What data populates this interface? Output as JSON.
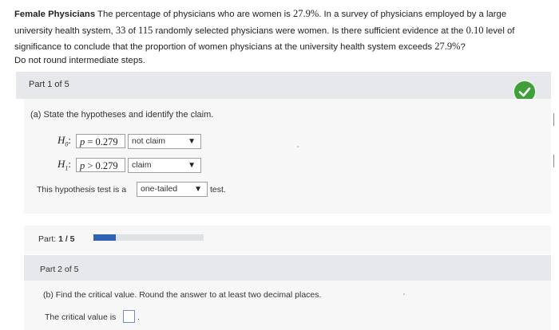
{
  "problem": {
    "title": "Female Physicians",
    "sentence1_a": " The percentage of physicians who are women is ",
    "pct": "27.9%",
    "sentence1_b": ". In a survey of physicians employed by a large",
    "line2_a": "university health system, ",
    "n_selected": "33",
    "line2_of": " of ",
    "n_total": "115",
    "line2_b": " randomly selected physicians were women. Is there sufficient evidence at the ",
    "alpha": "0.10",
    "line2_c": " level of",
    "line3_a": "significance to conclude that the proportion of women physicians at the university health system exceeds ",
    "pct2": "27.9%",
    "line3_b": "?",
    "line4": "Do not round intermediate steps."
  },
  "part1": {
    "header": "Part 1 of 5",
    "question": "(a) State the hypotheses and identify the claim.",
    "h0": {
      "label": "H",
      "sub": "0",
      "colon": ":",
      "expr_p": "p",
      "expr_rest": " = 0.279",
      "claim_select": "not claim"
    },
    "h1": {
      "label": "H",
      "sub": "1",
      "colon": ":",
      "expr_p": "p",
      "expr_rest": " > 0.279",
      "claim_select": "claim"
    },
    "test_prefix": "This hypothesis test is a",
    "test_select": "one-tailed",
    "test_suffix": "test.",
    "status_icon": "checkmark-icon"
  },
  "progress": {
    "label_prefix": "Part: ",
    "label_value": "1 / 5",
    "fraction": 0.2
  },
  "part2": {
    "header": "Part 2 of 5",
    "question": "(b) Find the critical value. Round the answer to at least two decimal places.",
    "answer_prefix": "The critical value is",
    "answer_value": "",
    "answer_suffix": "."
  },
  "colors": {
    "check_green": "#3f9f3a",
    "progress_blue": "#2f63b3",
    "panel_gray": "#e6e8eb"
  }
}
